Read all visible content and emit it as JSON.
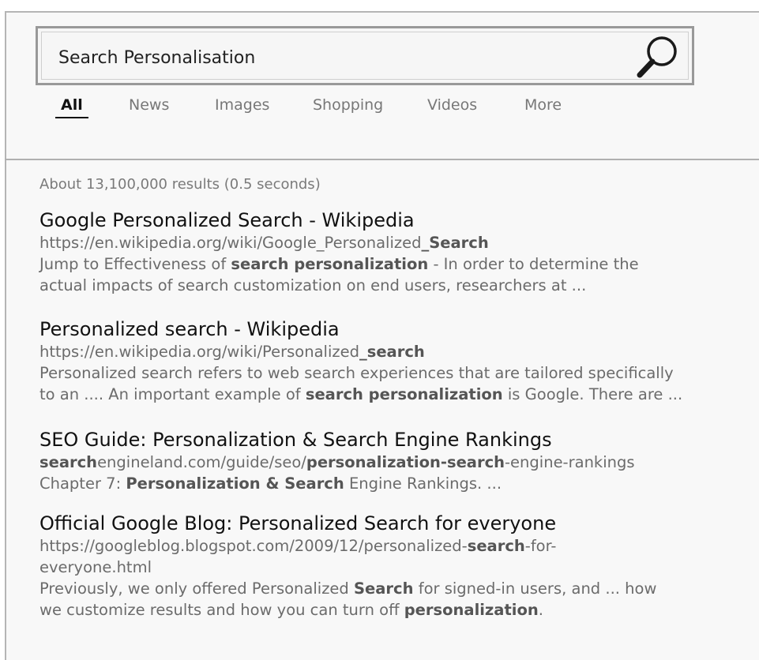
{
  "search": {
    "query": "Search Personalisation"
  },
  "tabs": [
    {
      "label": "All",
      "active": true
    },
    {
      "label": "News"
    },
    {
      "label": "Images"
    },
    {
      "label": "Shopping"
    },
    {
      "label": "Videos"
    },
    {
      "label": "More"
    }
  ],
  "stats": "About 13,100,000 results (0.5 seconds)",
  "results": [
    {
      "title": "Google Personalized Search - Wikipedia",
      "url": [
        "https://en.wikipedia.org/wiki/Google_Personalized",
        "_Search",
        ""
      ],
      "snippet1": [
        "Jump to Effectiveness of ",
        "search personalization",
        " - In order to determine the"
      ],
      "snippet2": "actual impacts of search customization on end users, researchers at ..."
    },
    {
      "title": "Personalized search - Wikipedia",
      "url": [
        "https://en.wikipedia.org/wiki/Personalized",
        "_search",
        ""
      ],
      "snippet1": [
        "Personalized search refers to web search experiences that are tailored specifically",
        "",
        ""
      ],
      "snippet2": [
        "to an .... An important example of ",
        "search personalization",
        " is Google. There are ..."
      ]
    },
    {
      "title": "SEO Guide: Personalization & Search Engine Rankings",
      "url": [
        "search",
        "engineland.com/guide/seo/",
        "personalization-search",
        "-engine-rankings"
      ],
      "snippet1": [
        "Chapter 7: ",
        "Personalization & Search",
        " Engine Rankings. ..."
      ]
    },
    {
      "title": "Official Google Blog: Personalized Search for everyone",
      "url1": [
        "https://googleblog.blogspot.com/2009/12/personalized-",
        "search",
        "-for-"
      ],
      "url2": "everyone.html",
      "snippet1": [
        "Previously, we only offered Personalized ",
        "Search",
        " for signed-in users, and ... how"
      ],
      "snippet2": [
        "we customize results and how you can turn off ",
        "personalization",
        "."
      ]
    }
  ]
}
